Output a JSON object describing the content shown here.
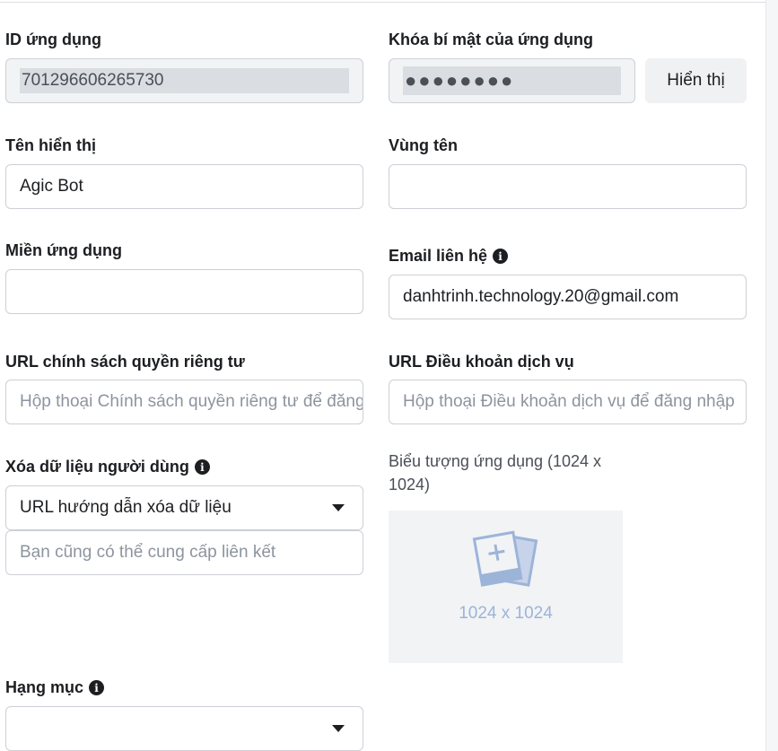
{
  "app_id": {
    "label": "ID ứng dụng",
    "value": "701296606265730"
  },
  "app_secret": {
    "label": "Khóa bí mật của ứng dụng",
    "value": "●●●●●●●●",
    "show_button": "Hiển thị"
  },
  "display_name": {
    "label": "Tên hiển thị",
    "value": "Agic Bot"
  },
  "namespace": {
    "label": "Vùng tên",
    "value": ""
  },
  "app_domains": {
    "label": "Miền ứng dụng",
    "value": ""
  },
  "contact_email": {
    "label": "Email liên hệ",
    "value": "danhtrinh.technology.20@gmail.com"
  },
  "privacy_url": {
    "label": "URL chính sách quyền riêng tư",
    "placeholder": "Hộp thoại Chính sách quyền riêng tư để đăng nhập"
  },
  "terms_url": {
    "label": "URL Điều khoản dịch vụ",
    "placeholder": "Hộp thoại Điều khoản dịch vụ để đăng nhập"
  },
  "data_deletion": {
    "label": "Xóa dữ liệu người dùng",
    "selected": "URL hướng dẫn xóa dữ liệu",
    "placeholder": "Bạn cũng có thể cung cấp liên kết"
  },
  "app_icon": {
    "label": "Biểu tượng ứng dụng (1024 x 1024)",
    "dimension_text": "1024 x 1024"
  },
  "category": {
    "label": "Hạng mục",
    "selected": ""
  },
  "colors": {
    "field_border": "#ccd0d5",
    "readonly_bg": "#f2f3f5",
    "icon_tint": "#9cb4d8"
  },
  "icons": {
    "info": "info-icon",
    "dropdown": "caret-down-icon",
    "upload": "image-upload-icon"
  }
}
